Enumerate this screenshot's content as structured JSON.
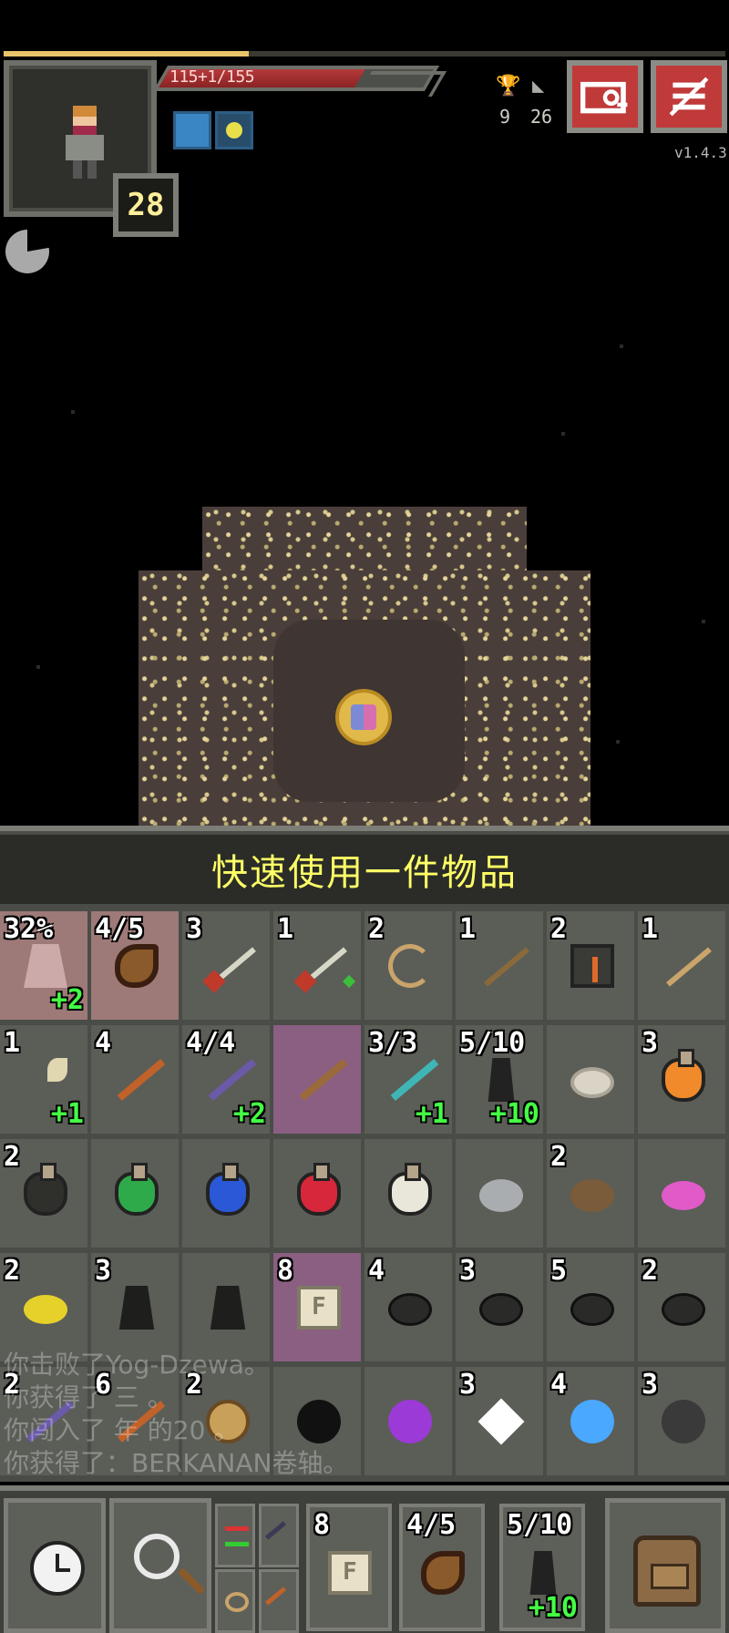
{
  "hud": {
    "xp_progress": 0.34,
    "hp_text": "115+1/155",
    "hp_current": 115,
    "hp_max": 155,
    "hero_level": "28",
    "stats": [
      {
        "icon": "trophy-icon",
        "value": "9"
      },
      {
        "icon": "stairs-icon",
        "value": "26"
      }
    ],
    "buffs": [
      "shield-buff-icon",
      "light-buff-icon"
    ],
    "version": "v1.4.3",
    "buttons": {
      "journal": "journal-icon",
      "menu": "menu-icon"
    }
  },
  "dungeon": {
    "item_on_floor": "amulet-icon"
  },
  "inventory": {
    "title": "快速使用一件物品",
    "slots": [
      {
        "qty": "32%",
        "bonus": "+2",
        "icon": "cloak-icon",
        "sprite": "s-cloak",
        "hl": "hl2"
      },
      {
        "qty": "4/5",
        "bonus": "",
        "icon": "horn-icon",
        "sprite": "s-horn",
        "hl": "hl2"
      },
      {
        "qty": "3",
        "bonus": "",
        "icon": "dart-icon",
        "sprite": "s-dart-red",
        "hl": ""
      },
      {
        "qty": "1",
        "bonus": "",
        "icon": "dart-icon",
        "sprite": "s-dart-green",
        "hl": ""
      },
      {
        "qty": "2",
        "bonus": "",
        "icon": "bolas-icon",
        "sprite": "s-whip",
        "hl": ""
      },
      {
        "qty": "1",
        "bonus": "",
        "icon": "hammer-icon",
        "sprite": "s-tool",
        "hl": ""
      },
      {
        "qty": "2",
        "bonus": "",
        "icon": "block-icon",
        "sprite": "s-block",
        "hl": ""
      },
      {
        "qty": "1",
        "bonus": "",
        "icon": "spear-icon",
        "sprite": "s-stick",
        "hl": ""
      },
      {
        "qty": "1",
        "bonus": "+1",
        "icon": "pickaxe-icon",
        "sprite": "s-axe",
        "hl": ""
      },
      {
        "qty": "4",
        "bonus": "",
        "icon": "wand-icon",
        "sprite": "s-wand w-orange",
        "hl": ""
      },
      {
        "qty": "4/4",
        "bonus": "+2",
        "icon": "wand-icon",
        "sprite": "s-wand w-purple",
        "hl": ""
      },
      {
        "qty": "",
        "bonus": "",
        "icon": "wand-icon",
        "sprite": "s-wand w-brown",
        "hl": "hl"
      },
      {
        "qty": "3/3",
        "bonus": "+1",
        "icon": "wand-icon",
        "sprite": "s-wand w-teal",
        "hl": ""
      },
      {
        "qty": "5/10",
        "bonus": "+10",
        "icon": "artifact-icon",
        "sprite": "s-dark",
        "hl": ""
      },
      {
        "qty": "",
        "bonus": "",
        "icon": "disc-icon",
        "sprite": "s-disc",
        "hl": ""
      },
      {
        "qty": "3",
        "bonus": "",
        "icon": "potion-icon",
        "sprite": "flask f-orange",
        "hl": ""
      },
      {
        "qty": "2",
        "bonus": "",
        "icon": "potion-icon",
        "sprite": "flask f-clear",
        "hl": ""
      },
      {
        "qty": "",
        "bonus": "",
        "icon": "potion-icon",
        "sprite": "flask f-green",
        "hl": ""
      },
      {
        "qty": "",
        "bonus": "",
        "icon": "potion-icon",
        "sprite": "flask f-blue",
        "hl": ""
      },
      {
        "qty": "",
        "bonus": "",
        "icon": "potion-icon",
        "sprite": "flask f-red",
        "hl": ""
      },
      {
        "qty": "",
        "bonus": "",
        "icon": "potion-icon",
        "sprite": "flask f-white",
        "hl": ""
      },
      {
        "qty": "",
        "bonus": "",
        "icon": "stone-icon",
        "sprite": "s-stone",
        "hl": ""
      },
      {
        "qty": "2",
        "bonus": "",
        "icon": "seed-icon",
        "sprite": "s-seed-brown",
        "hl": ""
      },
      {
        "qty": "",
        "bonus": "",
        "icon": "seed-icon",
        "sprite": "s-seed-pink",
        "hl": ""
      },
      {
        "qty": "2",
        "bonus": "",
        "icon": "seed-icon",
        "sprite": "s-seed-yellow",
        "hl": ""
      },
      {
        "qty": "3",
        "bonus": "",
        "icon": "flag-icon",
        "sprite": "s-totem",
        "hl": ""
      },
      {
        "qty": "",
        "bonus": "",
        "icon": "heart-icon",
        "sprite": "s-totem",
        "hl": ""
      },
      {
        "qty": "8",
        "bonus": "",
        "icon": "scroll-icon",
        "sprite": "s-scroll",
        "hl": "hl"
      },
      {
        "qty": "4",
        "bonus": "",
        "icon": "rune-icon",
        "sprite": "s-rune",
        "hl": ""
      },
      {
        "qty": "3",
        "bonus": "",
        "icon": "rune-icon",
        "sprite": "s-rune",
        "hl": ""
      },
      {
        "qty": "5",
        "bonus": "",
        "icon": "rune-icon",
        "sprite": "s-rune",
        "hl": ""
      },
      {
        "qty": "2",
        "bonus": "",
        "icon": "rune-icon",
        "sprite": "s-rune",
        "hl": ""
      },
      {
        "qty": "2",
        "bonus": "",
        "icon": "dagger-icon",
        "sprite": "s-wand w-purple",
        "hl": ""
      },
      {
        "qty": "6",
        "bonus": "",
        "icon": "torch-icon",
        "sprite": "s-wand w-orange",
        "hl": ""
      },
      {
        "qty": "2",
        "bonus": "",
        "icon": "pouch-icon",
        "sprite": "s-pouch",
        "hl": ""
      },
      {
        "qty": "",
        "bonus": "",
        "icon": "bomb-icon",
        "sprite": "s-bomb",
        "hl": ""
      },
      {
        "qty": "",
        "bonus": "",
        "icon": "gem-icon",
        "sprite": "s-gem-purple",
        "hl": ""
      },
      {
        "qty": "3",
        "bonus": "",
        "icon": "crystal-icon",
        "sprite": "s-gem-white",
        "hl": ""
      },
      {
        "qty": "4",
        "bonus": "",
        "icon": "orb-icon",
        "sprite": "s-orb-blue",
        "hl": ""
      },
      {
        "qty": "3",
        "bonus": "",
        "icon": "orb-icon",
        "sprite": "s-orb-dark",
        "hl": ""
      }
    ]
  },
  "log": [
    "你击败了Yog-Dzewa。",
    "你获得了     三  。",
    "你闯入了    年    的20 。",
    "你获得了：BERKANAN卷轴。"
  ],
  "toolbar": {
    "wait_icon": "clock-icon",
    "search_icon": "magnifier-icon",
    "quickslots": [
      {
        "qty": "8",
        "bonus": "",
        "icon": "scroll-icon",
        "sprite": "s-scroll"
      },
      {
        "qty": "4/5",
        "bonus": "",
        "icon": "horn-icon",
        "sprite": "s-horn"
      },
      {
        "qty": "5/10",
        "bonus": "+10",
        "icon": "artifact-icon",
        "sprite": "s-dark"
      }
    ],
    "backpack_icon": "backpack-icon"
  },
  "colors": {
    "panel": "#4a4c47",
    "slot": "#5b5d57",
    "title_text": "#ffff66",
    "hp": "#b53a3a",
    "bonus_text": "#44ff44"
  }
}
